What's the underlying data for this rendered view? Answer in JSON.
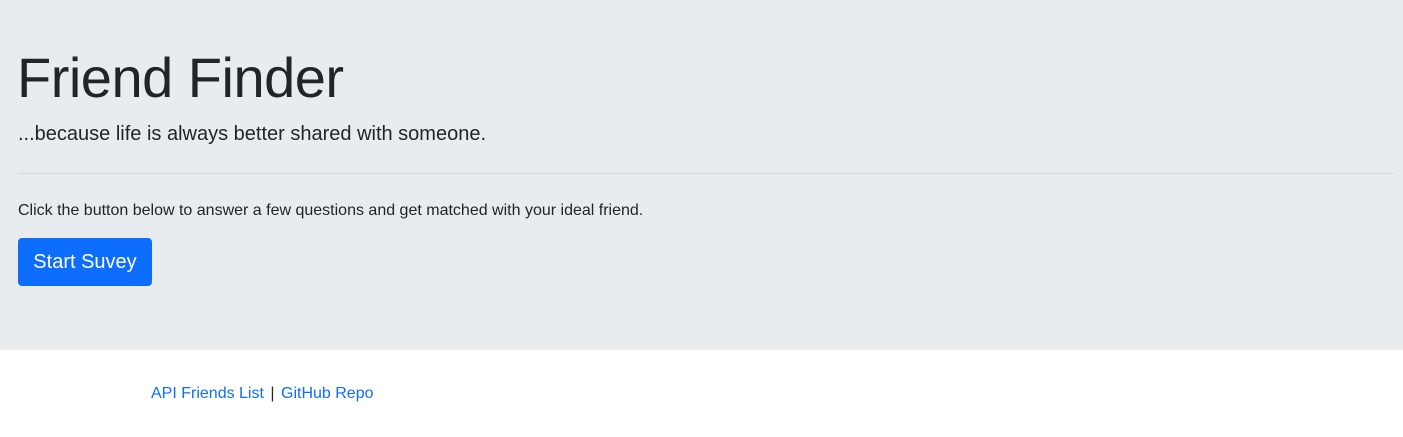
{
  "hero": {
    "title": "Friend Finder",
    "lead": "...because life is always better shared with someone.",
    "description": "Click the button below to answer a few questions and get matched with your ideal friend.",
    "start_button_label": "Start Suvey"
  },
  "footer": {
    "links": [
      {
        "label": "API Friends List"
      },
      {
        "label": "GitHub Repo"
      }
    ],
    "separator": "|"
  },
  "colors": {
    "jumbotron_bg": "#e9ecef",
    "primary": "#0d6efd",
    "text": "#212529"
  }
}
